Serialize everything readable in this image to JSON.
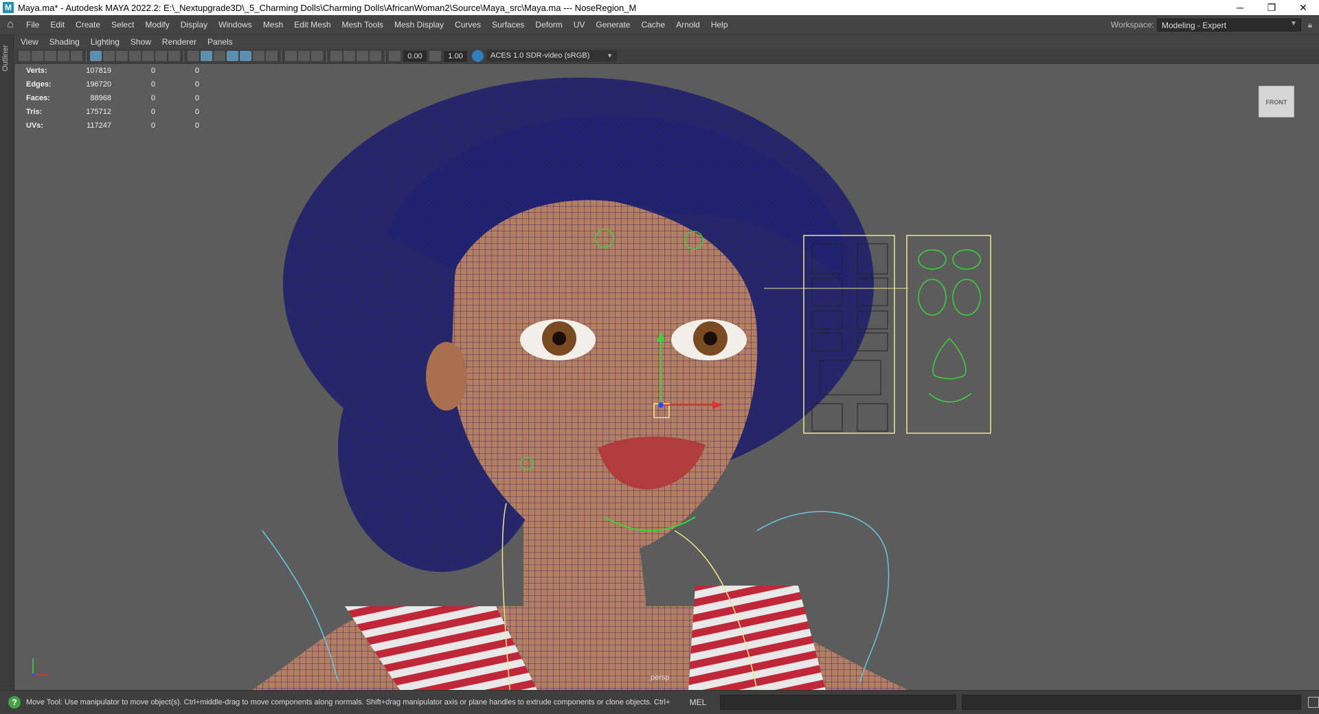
{
  "window": {
    "title": "Maya.ma* - Autodesk MAYA 2022.2: E:\\_Nextupgrade3D\\_5_Charming Dolls\\Charming Dolls\\AfricanWoman2\\Source\\Maya_src\\Maya.ma   ---   NoseRegion_M",
    "app_icon_letter": "M",
    "minimize": "─",
    "restore": "❐",
    "close": "✕"
  },
  "main_menu": [
    "File",
    "Edit",
    "Create",
    "Select",
    "Modify",
    "Display",
    "Windows",
    "Mesh",
    "Edit Mesh",
    "Mesh Tools",
    "Mesh Display",
    "Curves",
    "Surfaces",
    "Deform",
    "UV",
    "Generate",
    "Cache",
    "Arnold",
    "Help"
  ],
  "workspace": {
    "label": "Workspace:",
    "value": "Modeling - Expert"
  },
  "outliner_tab": "Outliner",
  "panel_menu": [
    "View",
    "Shading",
    "Lighting",
    "Show",
    "Renderer",
    "Panels"
  ],
  "view_toolbar": {
    "exposure": "0.00",
    "gamma": "1.00",
    "color_management": "ACES 1.0 SDR-video (sRGB)"
  },
  "hud": [
    {
      "label": "Verts:",
      "value": "107819",
      "sel": "0",
      "comp": "0"
    },
    {
      "label": "Edges:",
      "value": "196720",
      "sel": "0",
      "comp": "0"
    },
    {
      "label": "Faces:",
      "value": "88968",
      "sel": "0",
      "comp": "0"
    },
    {
      "label": "Tris:",
      "value": "175712",
      "sel": "0",
      "comp": "0"
    },
    {
      "label": "UVs:",
      "value": "117247",
      "sel": "0",
      "comp": "0"
    }
  ],
  "viewport": {
    "camera": "persp",
    "view_cube": "FRONT",
    "colors": {
      "background": "#5c5c5c",
      "wireframe": "#1a1a8c",
      "skin": "#b47e60",
      "control_yellow": "#f0e68c",
      "control_green": "#3bd43b"
    }
  },
  "status": {
    "help_line": "Move Tool: Use manipulator to move object(s). Ctrl+middle-drag to move components along normals. Shift+drag manipulator axis or plane handles to extrude components or clone objects. Ctrl+Shift+drag to constrain",
    "command_language": "MEL"
  }
}
